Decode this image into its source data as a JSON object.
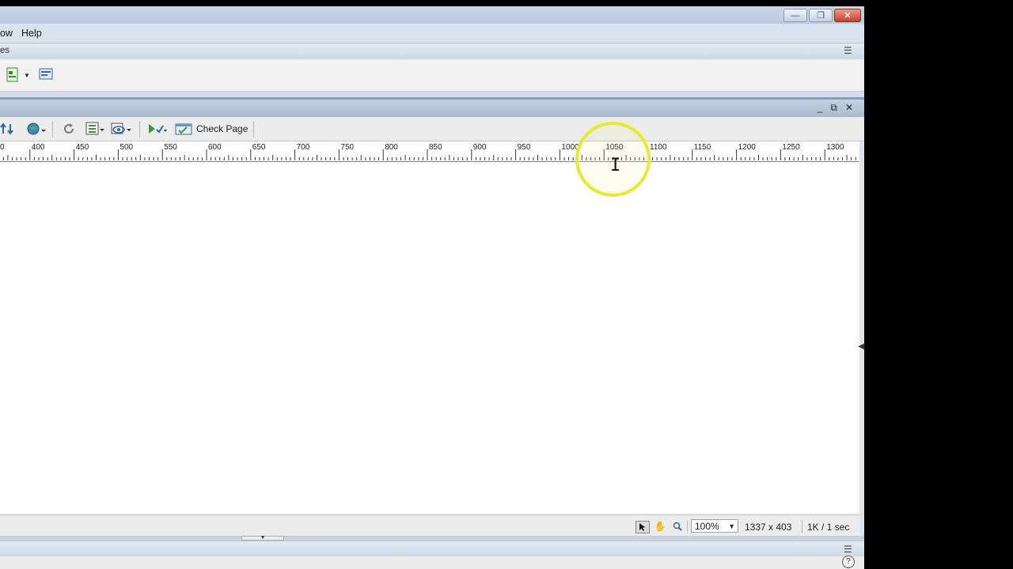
{
  "window_controls": {
    "minimize": "—",
    "restore": "❐",
    "close": "✕"
  },
  "menu": {
    "items": [
      "ow",
      "Help"
    ]
  },
  "insert_panel": {
    "label": "es"
  },
  "document": {
    "controls": {
      "minimize": "_",
      "restore": "⧉",
      "close": "✕"
    },
    "toolbar": {
      "check_page_label": "Check Page"
    },
    "ruler": {
      "ticks": [
        "0",
        "400",
        "450",
        "500",
        "550",
        "600",
        "650",
        "700",
        "750",
        "800",
        "850",
        "900",
        "950",
        "1000",
        "1050",
        "1100",
        "1150",
        "1200",
        "1250",
        "1300"
      ]
    },
    "status": {
      "zoom": "100%",
      "dimensions": "1337 x 403",
      "download": "1K / 1 sec"
    }
  },
  "colors": {
    "highlight_ring": "#e8ea30",
    "chrome": "#d4dde6"
  }
}
